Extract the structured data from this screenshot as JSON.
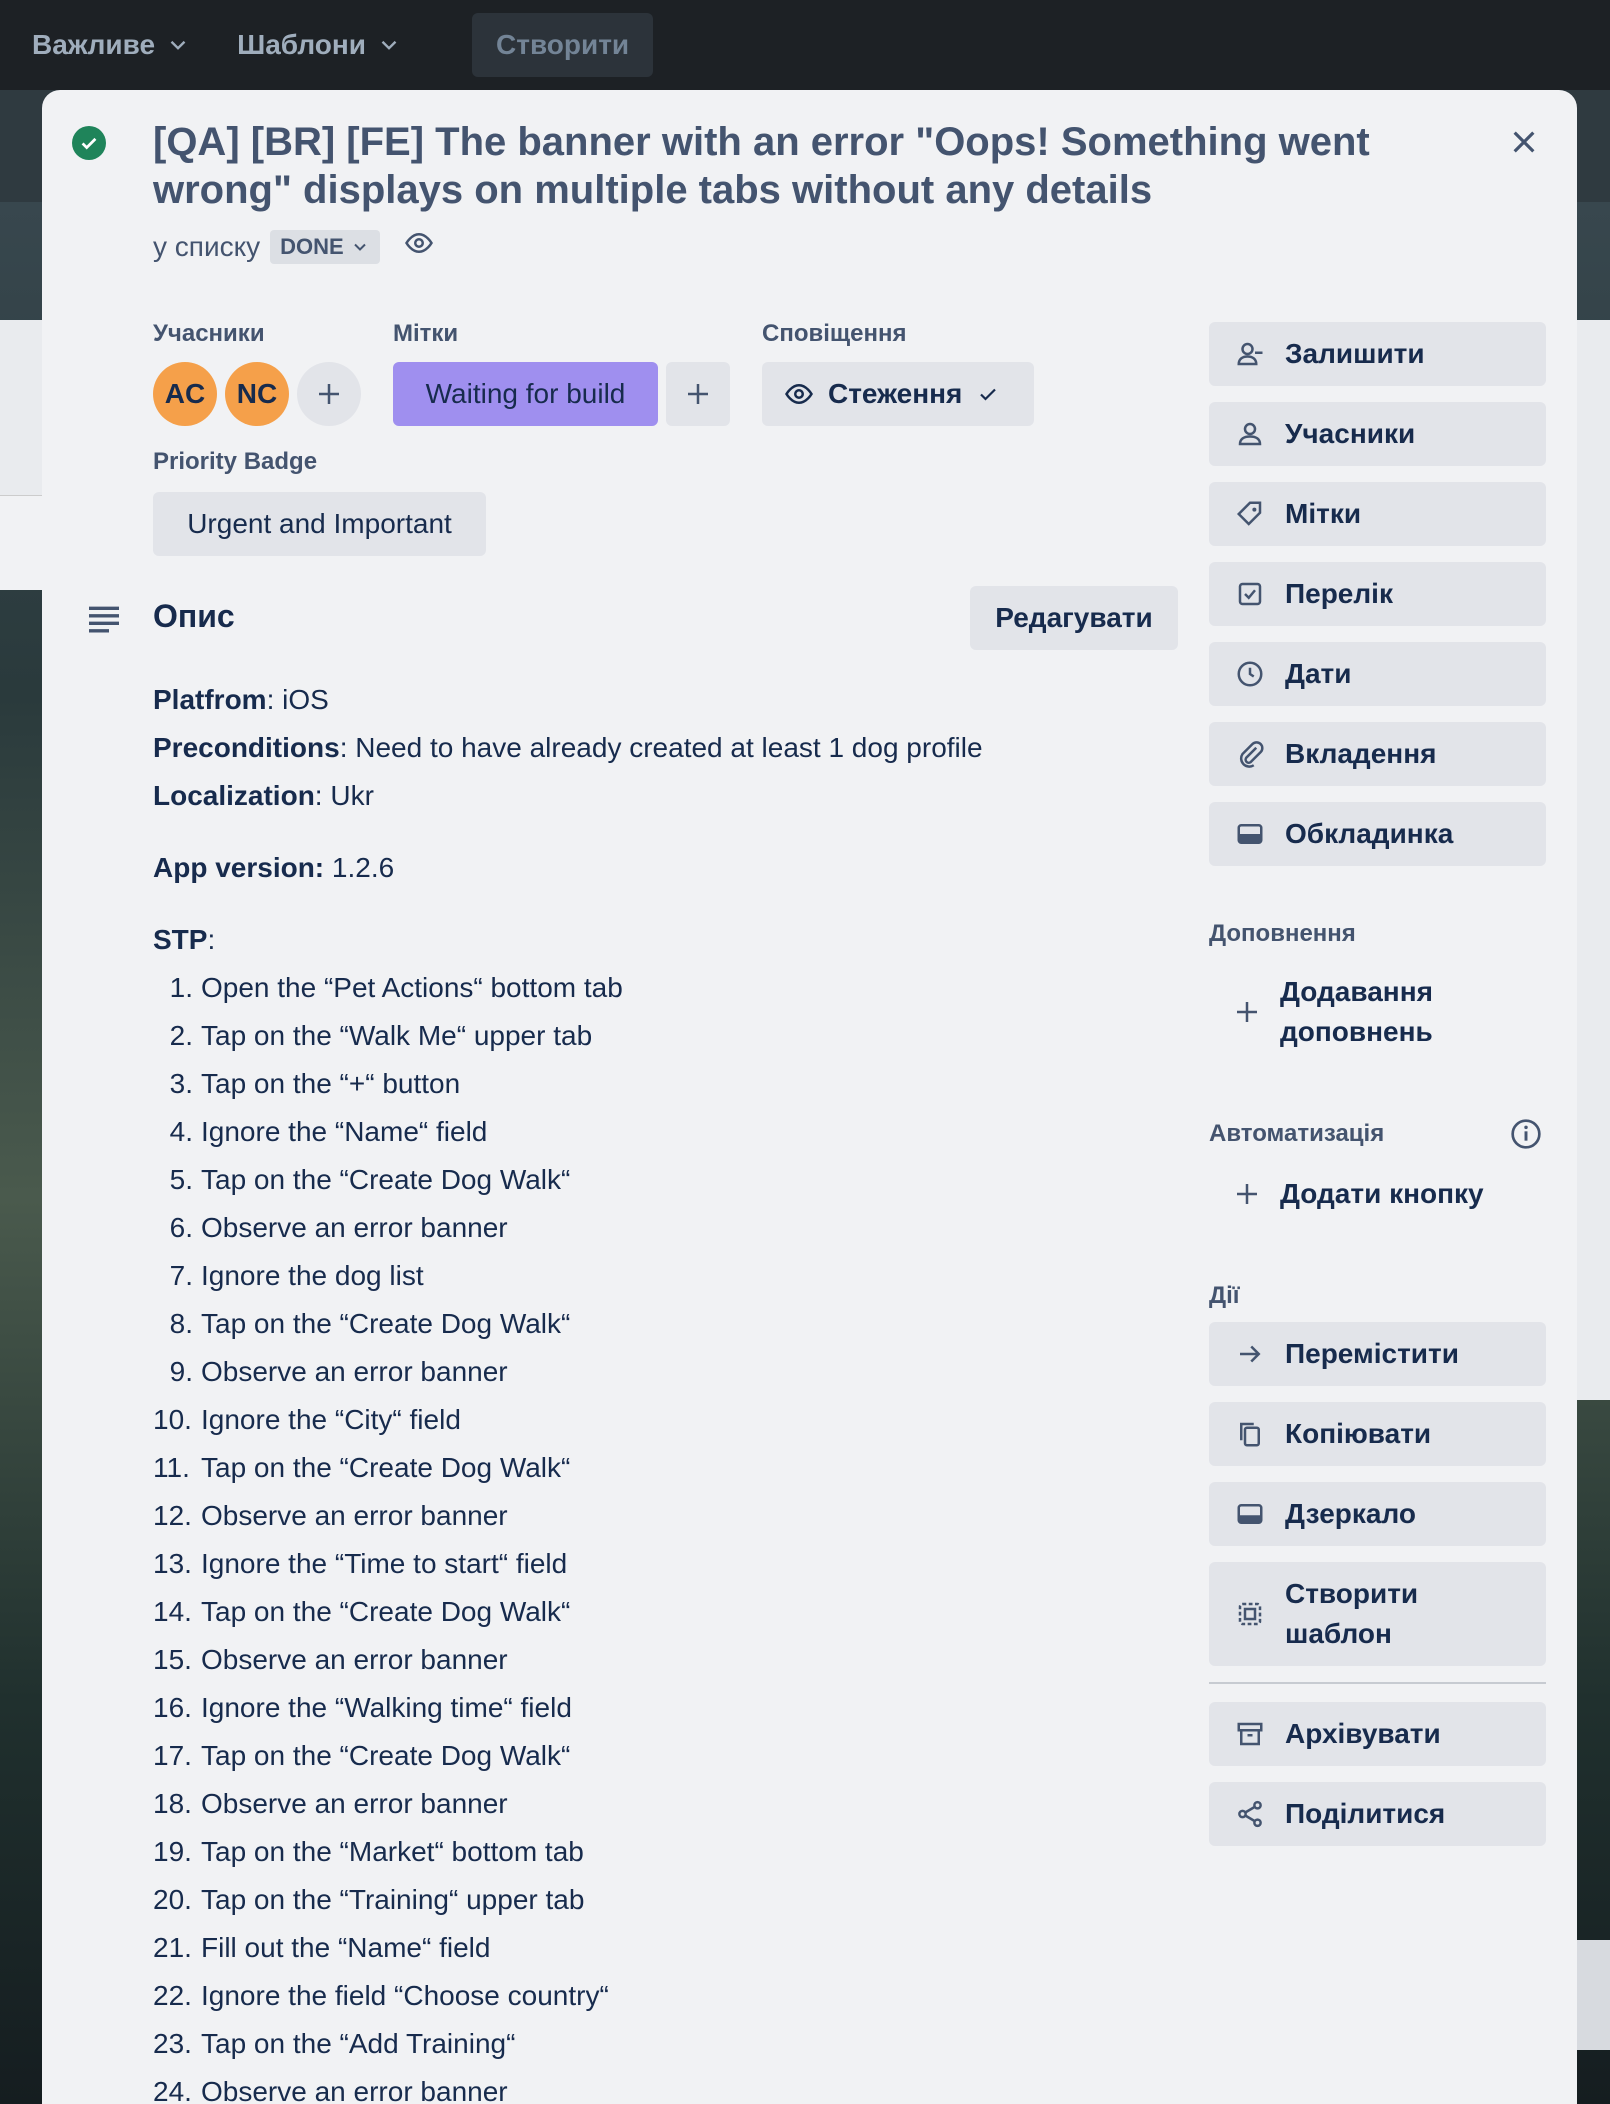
{
  "topbar": {
    "nav1": "Важливе",
    "nav2": "Шаблони",
    "create": "Створити"
  },
  "card": {
    "title": "[QA] [BR] [FE] The banner with an error \"Oops! Something went wrong\" displays on multiple tabs without any details",
    "in_list_prefix": "у списку",
    "list_name": "DONE"
  },
  "members": {
    "label": "Учасники",
    "avatars": [
      "AC",
      "NC"
    ]
  },
  "labels": {
    "label": "Мітки",
    "chip": "Waiting for build"
  },
  "notifications": {
    "label": "Сповіщення",
    "watch": "Стеження"
  },
  "priority": {
    "label": "Priority Badge",
    "value": "Urgent and Important"
  },
  "description": {
    "title": "Опис",
    "edit": "Редагувати",
    "platform_key": "Platfrom",
    "platform_val": ": iOS",
    "preconditions_key": "Preconditions",
    "preconditions_val": ": Need to have already created at least 1 dog profile",
    "localization_key": "Localization",
    "localization_val": ": Ukr",
    "app_version_key": "App version:",
    "app_version_val": " 1.2.6",
    "stp_key": "STP",
    "stp_suffix": ":",
    "steps": [
      "Open the “Pet Actions“ bottom tab",
      "Tap on the “Walk Me“ upper tab",
      "Tap on the “+“ button",
      "Ignore the “Name“ field",
      "Tap on the “Create Dog Walk“",
      "Observe an error banner",
      "Ignore the dog list",
      "Tap on the “Create Dog Walk“",
      "Observe an error banner",
      "Ignore the “City“ field",
      "Tap on the “Create Dog Walk“",
      "Observe an error banner",
      "Ignore the “Time to start“ field",
      "Tap on the “Create Dog Walk“",
      "Observe an error banner",
      "Ignore the “Walking time“ field",
      "Tap on the “Create Dog Walk“",
      "Observe an error banner",
      "Tap on the “Market“ bottom tab",
      "Tap on the “Training“ upper tab",
      "Fill out the “Name“ field",
      "Ignore the field “Choose country“",
      "Tap on the “Add Training“",
      "Observe an error banner"
    ]
  },
  "sidebar": {
    "add_to_card": [
      {
        "label": "Залишити",
        "icon": "person-minus-icon"
      },
      {
        "label": "Учасники",
        "icon": "person-icon"
      },
      {
        "label": "Мітки",
        "icon": "tag-icon"
      },
      {
        "label": "Перелік",
        "icon": "checklist-icon"
      },
      {
        "label": "Дати",
        "icon": "clock-icon"
      },
      {
        "label": "Вкладення",
        "icon": "paperclip-icon"
      },
      {
        "label": "Обкладинка",
        "icon": "cover-icon"
      }
    ],
    "powerups_label": "Доповнення",
    "powerups_add_line1": "Додавання",
    "powerups_add_line2": "доповнень",
    "automation_label": "Автоматизація",
    "automation_add": "Додати кнопку",
    "actions_label": "Дії",
    "actions": {
      "move": "Перемістити",
      "copy": "Копіювати",
      "mirror": "Дзеркало",
      "template_line1": "Створити",
      "template_line2": "шаблон",
      "archive": "Архівувати",
      "share": "Поділитися"
    }
  }
}
